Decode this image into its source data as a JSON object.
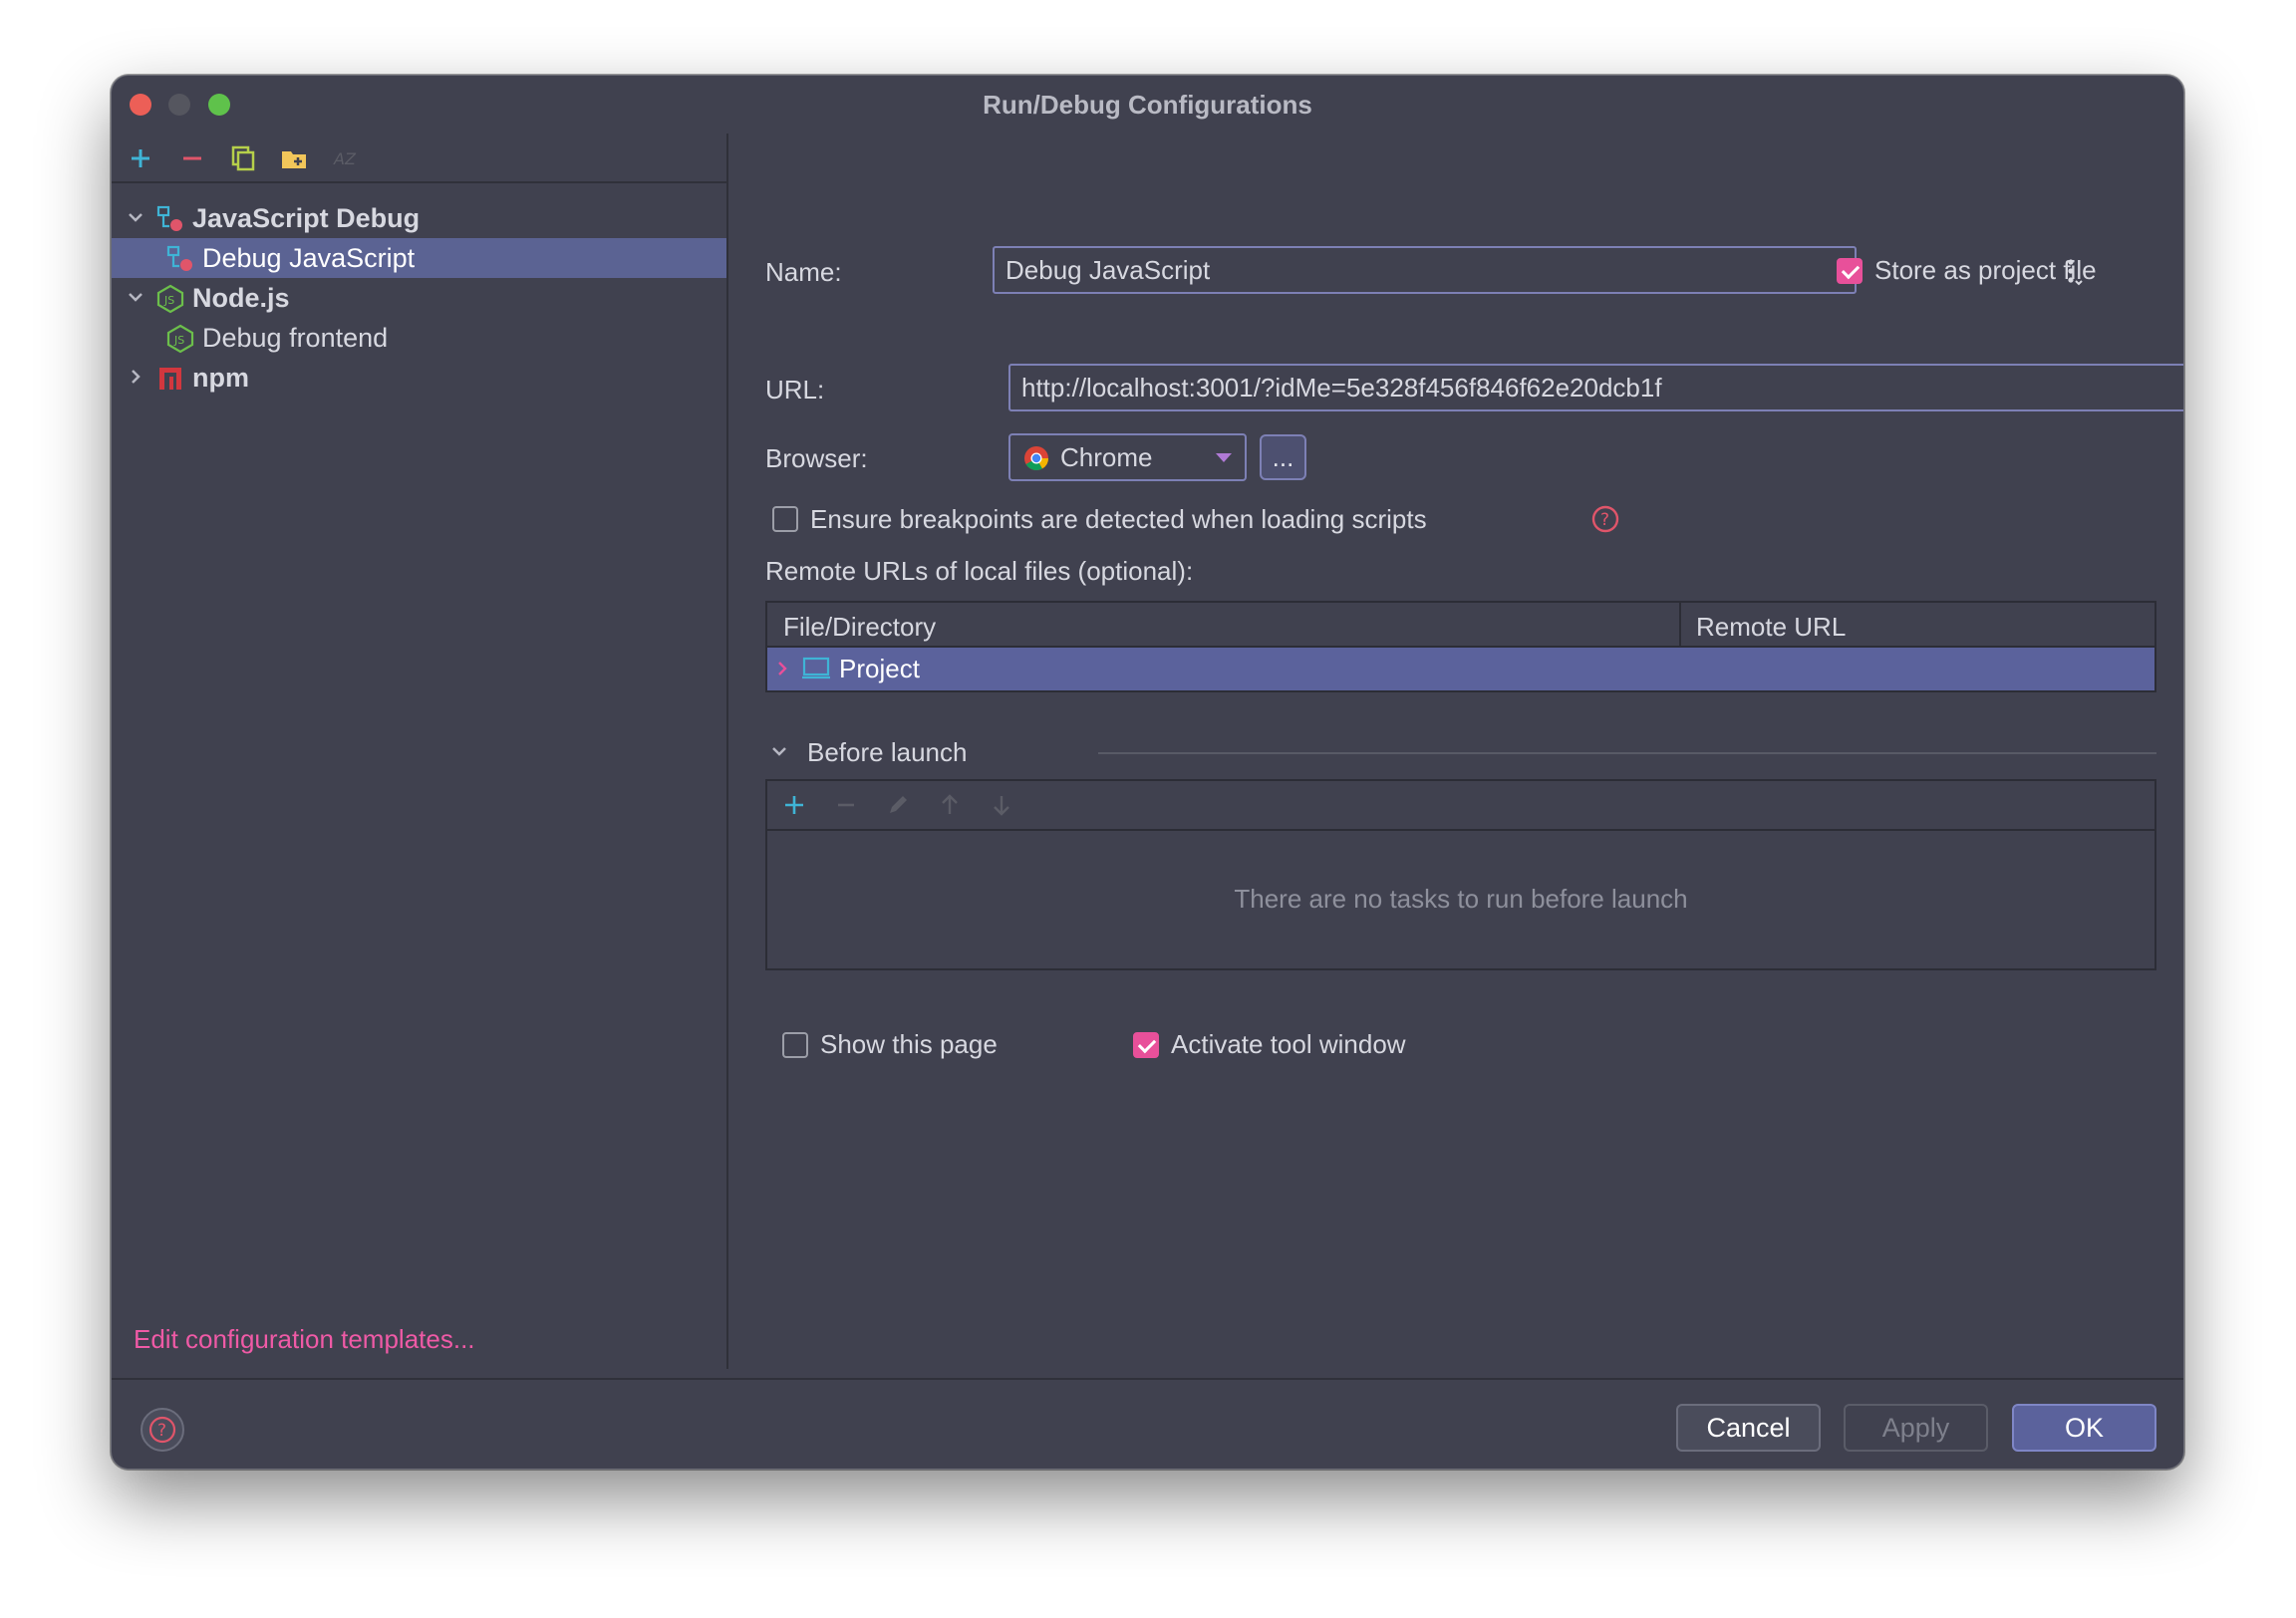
{
  "window": {
    "title": "Run/Debug Configurations"
  },
  "tree": {
    "items": [
      {
        "label": "JavaScript Debug"
      },
      {
        "label": "Debug JavaScript"
      },
      {
        "label": "Node.js"
      },
      {
        "label": "Debug frontend"
      },
      {
        "label": "npm"
      }
    ],
    "edit_templates": "Edit configuration templates..."
  },
  "form": {
    "name_label": "Name:",
    "name_value": "Debug JavaScript",
    "store_label": "Store as project file",
    "store_checked": true,
    "url_label": "URL:",
    "url_value": "http://localhost:3001/?idMe=5e328f456f846f62e20dcb1f",
    "browser_label": "Browser:",
    "browser_value": "Chrome",
    "browser_more": "...",
    "ensure_breakpoints_label": "Ensure breakpoints are detected when loading scripts",
    "ensure_breakpoints_checked": false,
    "remote_urls_label": "Remote URLs of local files (optional):"
  },
  "remote_table": {
    "columns": [
      "File/Directory",
      "Remote URL"
    ],
    "rows": [
      {
        "file": "Project",
        "remote": ""
      }
    ]
  },
  "before_launch": {
    "title": "Before launch",
    "empty_text": "There are no tasks to run before launch",
    "show_page_label": "Show this page",
    "show_page_checked": false,
    "activate_tool_label": "Activate tool window",
    "activate_tool_checked": true
  },
  "buttons": {
    "cancel": "Cancel",
    "apply": "Apply",
    "ok": "OK"
  },
  "colors": {
    "accent_pink": "#e8509a",
    "selection": "#5b6393",
    "background": "#40414f"
  }
}
